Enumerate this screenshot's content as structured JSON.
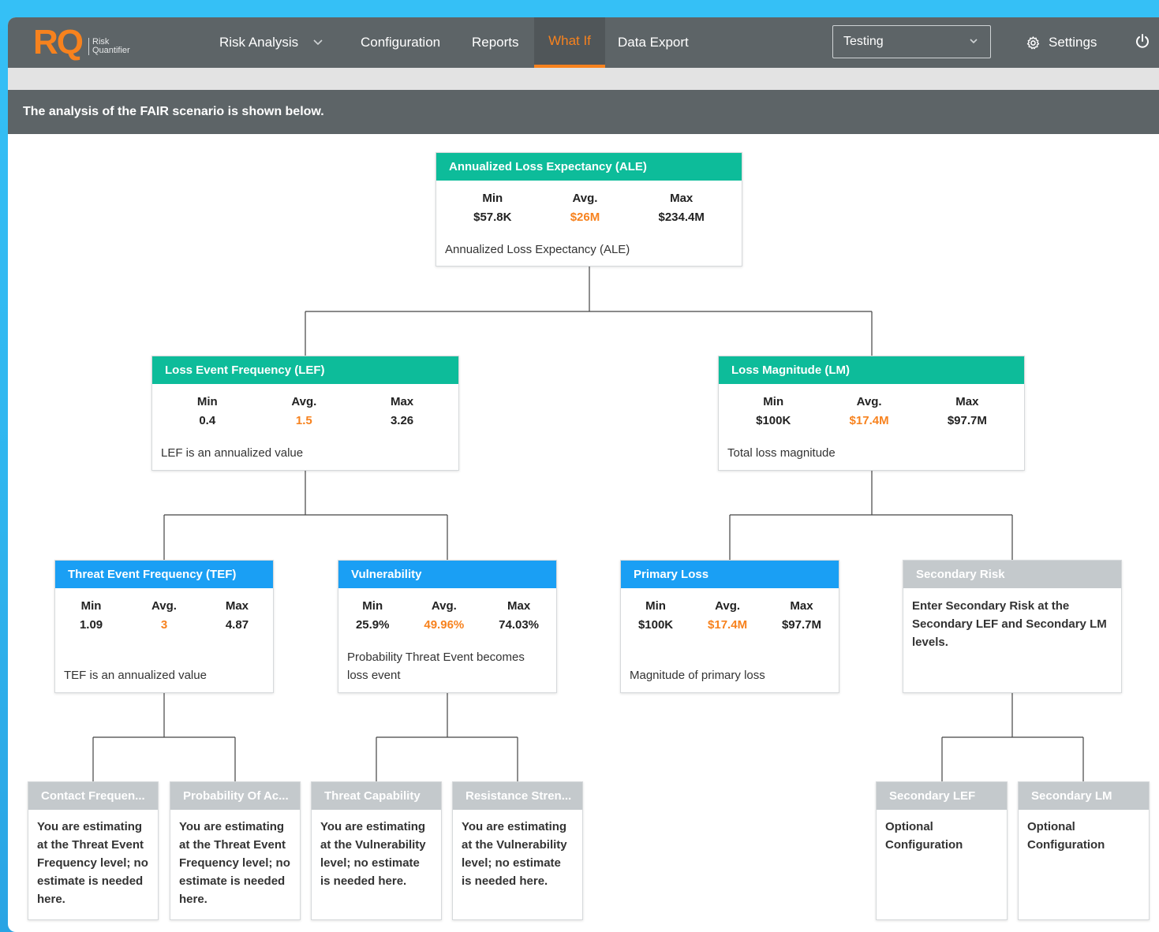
{
  "header": {
    "logo_mark": "RQ",
    "logo_sub_1": "Risk",
    "logo_sub_2": "Quantifier",
    "nav": {
      "risk_analysis": "Risk Analysis",
      "configuration": "Configuration",
      "reports": "Reports",
      "what_if": "What If",
      "data_export": "Data Export"
    },
    "scenario_select": "Testing",
    "settings": "Settings"
  },
  "banner": "The analysis of the FAIR scenario is shown below.",
  "stat_labels": {
    "min": "Min",
    "avg": "Avg.",
    "max": "Max"
  },
  "nodes": {
    "ale": {
      "title": "Annualized Loss Expectancy (ALE)",
      "min": "$57.8K",
      "avg": "$26M",
      "max": "$234.4M",
      "desc": "Annualized Loss Expectancy (ALE)"
    },
    "lef": {
      "title": "Loss Event Frequency (LEF)",
      "min": "0.4",
      "avg": "1.5",
      "max": "3.26",
      "desc": "LEF is an annualized value"
    },
    "lm": {
      "title": "Loss Magnitude (LM)",
      "min": "$100K",
      "avg": "$17.4M",
      "max": "$97.7M",
      "desc": "Total loss magnitude"
    },
    "tef": {
      "title": "Threat Event Frequency (TEF)",
      "min": "1.09",
      "avg": "3",
      "max": "4.87",
      "desc": "TEF is an annualized value"
    },
    "vuln": {
      "title": "Vulnerability",
      "min": "25.9%",
      "avg": "49.96%",
      "max": "74.03%",
      "desc": "Probability Threat Event becomes loss event"
    },
    "primary": {
      "title": "Primary Loss",
      "min": "$100K",
      "avg": "$17.4M",
      "max": "$97.7M",
      "desc": "Magnitude of primary loss"
    },
    "secondary_risk": {
      "title": "Secondary Risk",
      "note": "Enter Secondary Risk at the Secondary LEF and Secondary LM levels."
    },
    "contact_freq": {
      "title": "Contact Frequen...",
      "note": "You are estimating at the Threat Event Frequency level; no estimate is needed here."
    },
    "prob_action": {
      "title": "Probability Of Ac...",
      "note": "You are estimating at the Threat Event Frequency level; no estimate is needed here."
    },
    "threat_cap": {
      "title": "Threat Capability",
      "note": "You are estimating at the Vulnerability level; no estimate is needed here."
    },
    "resistance": {
      "title": "Resistance Stren...",
      "note": "You are estimating at the Vulnerability level; no estimate is needed here."
    },
    "secondary_lef": {
      "title": "Secondary LEF",
      "note": "Optional Configuration"
    },
    "secondary_lm": {
      "title": "Secondary LM",
      "note": "Optional Configuration"
    }
  },
  "colors": {
    "accent": "#f7821e",
    "teal": "#0dbc9a",
    "blue": "#1a9ff4",
    "gray": "#c4c9cc",
    "nav_bg": "#5d6467"
  }
}
